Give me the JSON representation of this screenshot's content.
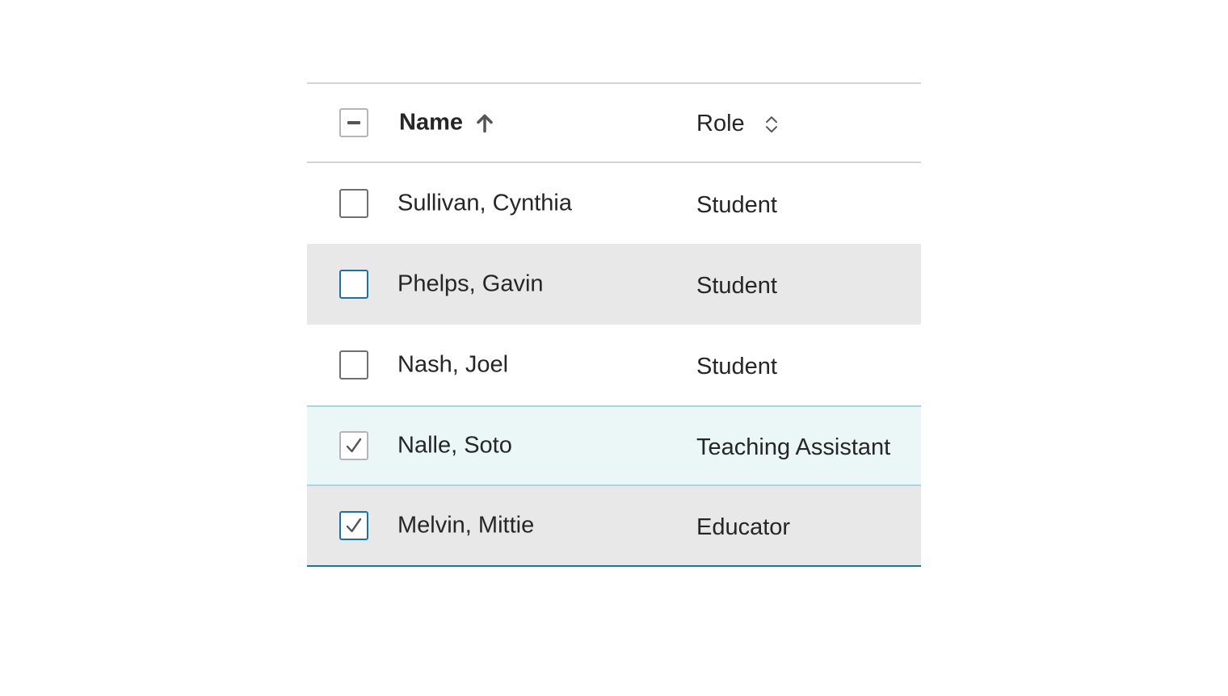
{
  "table": {
    "header": {
      "select_all_state": "indeterminate",
      "name_label": "Name",
      "name_sort": "ascending",
      "role_label": "Role",
      "role_sort": "unsorted"
    },
    "rows": [
      {
        "name": "Sullivan, Cynthia",
        "role": "Student",
        "checked": false
      },
      {
        "name": "Phelps, Gavin",
        "role": "Student",
        "checked": false
      },
      {
        "name": "Nash, Joel",
        "role": "Student",
        "checked": false
      },
      {
        "name": "Nalle, Soto",
        "role": "Teaching Assistant",
        "checked": true
      },
      {
        "name": "Melvin, Mittie",
        "role": "Educator",
        "checked": true
      }
    ]
  },
  "colors": {
    "focus_accent": "#1a73a8",
    "selected_row_bg": "#ebf7f7",
    "selected_row_border": "#a3d8dc",
    "hover_row_bg": "#e8e8e8"
  }
}
